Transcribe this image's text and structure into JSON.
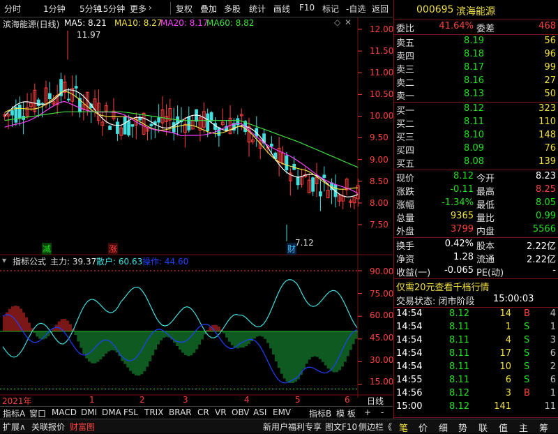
{
  "toolbar": {
    "items": [
      "分时",
      "1分钟",
      "5分钟",
      "15分钟",
      "更多",
      "复权",
      "叠加",
      "多股",
      "统计",
      "画线",
      "F10",
      "标记",
      "-自选",
      "返回"
    ],
    "more_arrow": "›"
  },
  "chart": {
    "title": "滨海能源(日线)",
    "ma5_label": "MA5: 8.21",
    "ma10_label": "MA10: 8.27",
    "ma20_label": "MA20: 8.17",
    "ma60_label": "MA60: 8.82",
    "high_mark": "11.97",
    "low_mark": "7.12",
    "price_ticks": [
      "12.00",
      "11.50",
      "11.00",
      "10.50",
      "10.00",
      "9.50",
      "9.00",
      "8.50",
      "8.00",
      "7.50"
    ],
    "markers": {
      "jian": "减",
      "zhang": "涨",
      "cai": "财"
    },
    "colors": {
      "ma5": "#ffffff",
      "ma10": "#f0e040",
      "ma20": "#ff40ff",
      "ma60": "#40e040",
      "up": "#ff4040",
      "down": "#40e0e0"
    }
  },
  "indicator": {
    "title": "指标公式",
    "main_label": "主力: 39.37",
    "retail_label": "散户: 60.63",
    "op_label": "操作: 44.60",
    "ticks": [
      "90.00",
      "75.00",
      "60.00",
      "45.00",
      "30.00",
      "15.00"
    ]
  },
  "x_axis": {
    "labels": [
      "2021年",
      "1",
      "2",
      "3",
      "4",
      "5",
      "6"
    ],
    "period": "日线"
  },
  "tabs": [
    "指标A",
    "窗口",
    "MACD",
    "DMI",
    "DMA",
    "FSL",
    "TRIX",
    "BRAR",
    "CR",
    "VR",
    "OBV",
    "ASI",
    "EMV",
    "指标B",
    "模 板",
    "+",
    "-"
  ],
  "status": {
    "left": [
      "扩展∧",
      "关联报价",
      "财富图"
    ],
    "right": [
      "新用户福利专享",
      "图文F10",
      "侧边栏《"
    ]
  },
  "panel": {
    "code": "000695",
    "name": "滨海能源",
    "webi_label": "委比",
    "webi_value": "41.64%",
    "wecha_label": "委差",
    "wecha_value": "468",
    "asks": [
      {
        "label": "卖五",
        "price": "8.19",
        "vol": "56"
      },
      {
        "label": "卖四",
        "price": "8.18",
        "vol": "96"
      },
      {
        "label": "卖三",
        "price": "8.17",
        "vol": "99"
      },
      {
        "label": "卖二",
        "price": "8.16",
        "vol": "27"
      },
      {
        "label": "卖一",
        "price": "8.13",
        "vol": "50"
      }
    ],
    "bids": [
      {
        "label": "买一",
        "price": "8.12",
        "vol": "323"
      },
      {
        "label": "买二",
        "price": "8.11",
        "vol": "110"
      },
      {
        "label": "买三",
        "price": "8.10",
        "vol": "148"
      },
      {
        "label": "买四",
        "price": "8.09",
        "vol": "76"
      },
      {
        "label": "买五",
        "price": "8.08",
        "vol": "139"
      }
    ],
    "stats": [
      {
        "l1": "现价",
        "v1": "8.12",
        "c1": "green",
        "l2": "今开",
        "v2": "8.23",
        "c2": "white"
      },
      {
        "l1": "涨跌",
        "v1": "-0.11",
        "c1": "green",
        "l2": "最高",
        "v2": "8.25",
        "c2": "red"
      },
      {
        "l1": "涨幅",
        "v1": "-1.34%",
        "c1": "green",
        "l2": "最低",
        "v2": "8.05",
        "c2": "green"
      },
      {
        "l1": "总量",
        "v1": "9365",
        "c1": "yellow",
        "l2": "量比",
        "v2": "0.99",
        "c2": "green"
      },
      {
        "l1": "外盘",
        "v1": "3799",
        "c1": "red",
        "l2": "内盘",
        "v2": "5566",
        "c2": "green"
      }
    ],
    "fin": [
      {
        "l1": "换手",
        "v1": "0.42%",
        "l2": "股本",
        "v2": "2.22亿"
      },
      {
        "l1": "净资",
        "v1": "1.28",
        "l2": "流通",
        "v2": "2.22亿"
      },
      {
        "l1": "收益(一)",
        "v1": "-0.065",
        "l2": "PE(动)",
        "v2": "-"
      }
    ],
    "promo": "仅需20元查看千档行情",
    "trade_status": "交易状态: 闭市阶段",
    "trade_time": "15:00:03",
    "ticks": [
      {
        "t": "14:54",
        "p": "8.12",
        "v": "14",
        "d": "B",
        "n": "4"
      },
      {
        "t": "14:54",
        "p": "8.11",
        "v": "1",
        "d": "S",
        "n": "1"
      },
      {
        "t": "14:54",
        "p": "8.11",
        "v": "4",
        "d": "S",
        "n": "3"
      },
      {
        "t": "14:54",
        "p": "8.11",
        "v": "17",
        "d": "S",
        "n": "6"
      },
      {
        "t": "14:54",
        "p": "8.11",
        "v": "10",
        "d": "S",
        "n": "2"
      },
      {
        "t": "14:55",
        "p": "8.11",
        "v": "6",
        "d": "S",
        "n": "6"
      },
      {
        "t": "14:56",
        "p": "8.12",
        "v": "3",
        "d": "B",
        "n": "1"
      },
      {
        "t": "15:00",
        "p": "8.12",
        "v": "141",
        "d": "",
        "n": "11"
      }
    ],
    "bottom_tabs": [
      "笔",
      "价",
      "细",
      "势",
      "联",
      "值",
      "主",
      "筹"
    ]
  },
  "chart_data": [
    {
      "type": "line",
      "title": "",
      "x": [
        "2021年",
        "1",
        "2",
        "3",
        "4",
        "5",
        "6"
      ],
      "series": [
        {
          "name": "MA5",
          "values": [
            10.0,
            10.6,
            9.8,
            9.9,
            9.8,
            8.6,
            8.21
          ]
        },
        {
          "name": "MA10",
          "values": [
            10.0,
            10.5,
            9.9,
            9.7,
            9.7,
            8.7,
            8.27
          ]
        },
        {
          "name": "MA20",
          "values": [
            9.7,
            10.3,
            10.0,
            9.5,
            9.8,
            8.9,
            8.17
          ]
        },
        {
          "name": "MA60",
          "values": [
            9.9,
            10.1,
            10.1,
            9.9,
            9.9,
            9.4,
            8.82
          ]
        }
      ],
      "ylim": [
        7.12,
        12.2
      ]
    },
    {
      "type": "line",
      "title": "",
      "series": [
        {
          "name": "主力",
          "values": [
            60,
            50,
            25,
            42,
            48,
            20,
            39.37
          ]
        },
        {
          "name": "散户",
          "values": [
            40,
            50,
            75,
            58,
            52,
            80,
            60.63
          ]
        },
        {
          "name": "操作",
          "values": [
            55,
            45,
            35,
            50,
            45,
            15,
            44.6
          ]
        }
      ],
      "ylim": [
        10,
        95
      ]
    }
  ]
}
